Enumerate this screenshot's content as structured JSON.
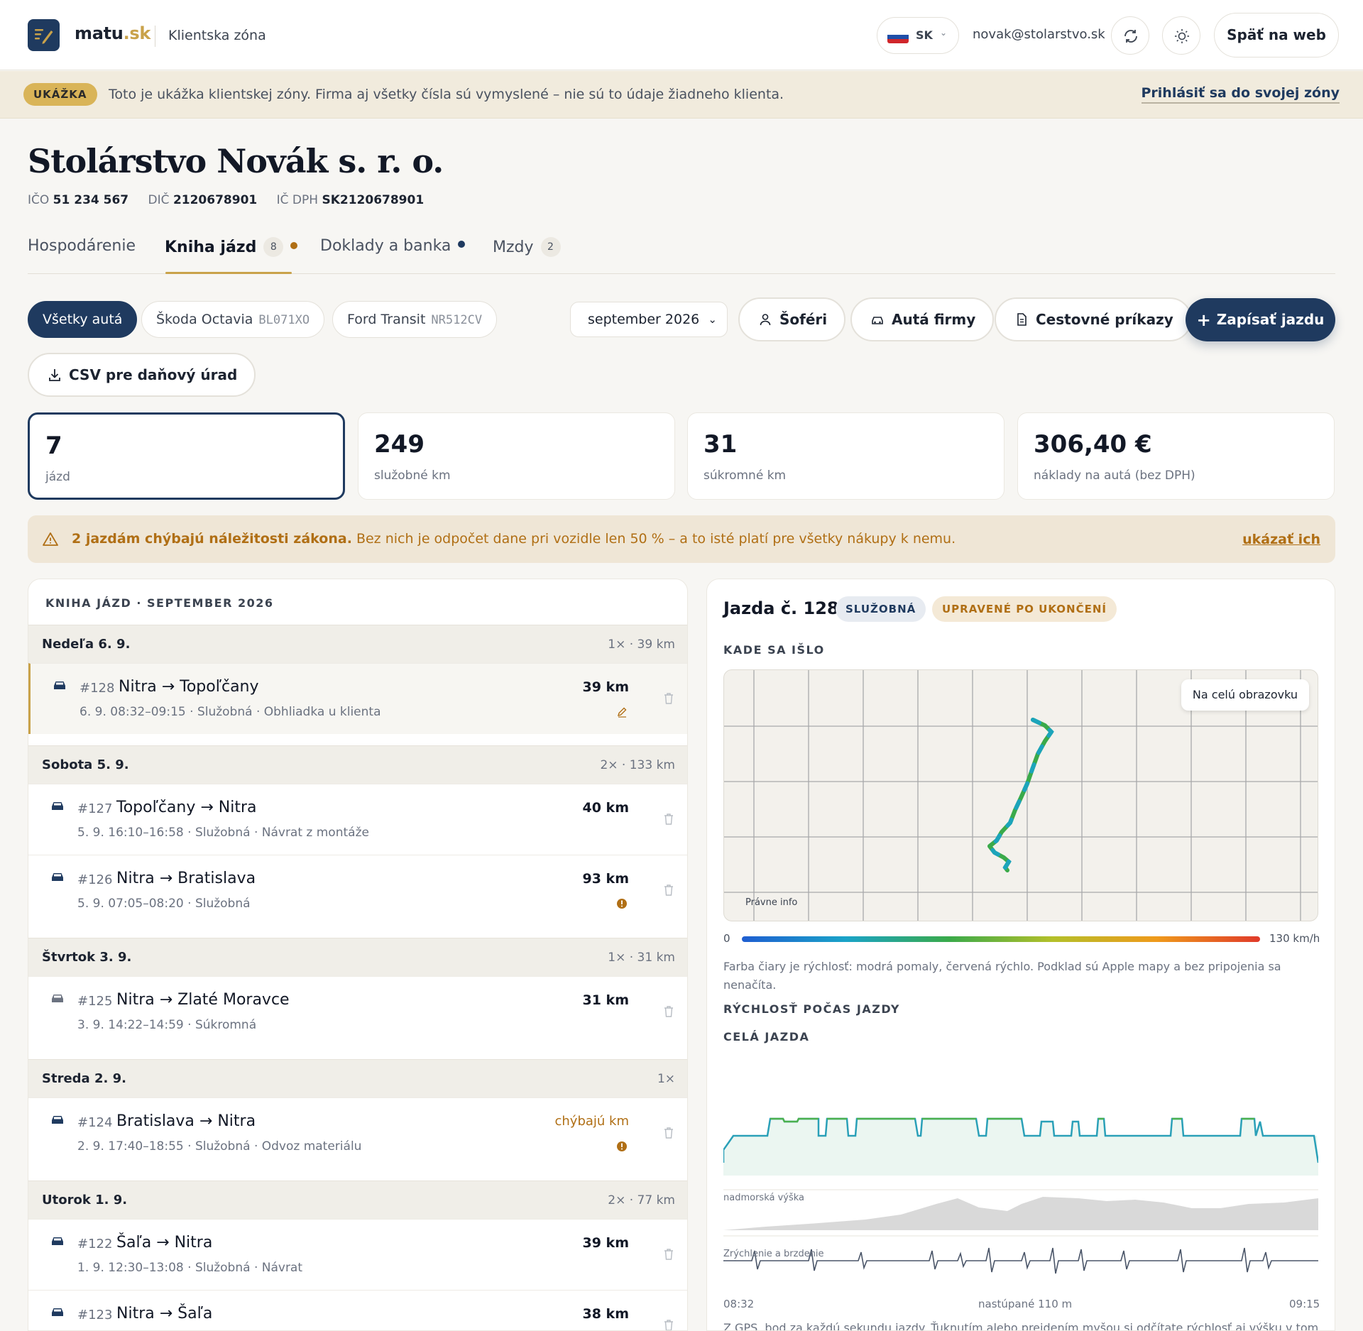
{
  "header": {
    "brand_main": "matu",
    "brand_tld": ".sk",
    "zone_title": "Klientska zóna",
    "lang_code": "SK",
    "user_email": "novak@stolarstvo.sk",
    "back_label": "Späť na web"
  },
  "demo": {
    "badge": "UKÁŽKA",
    "text": "Toto je ukážka klientskej zóny. Firma aj všetky čísla sú vymyslené – nie sú to údaje žiadneho klienta.",
    "login_link": "Prihlásiť sa do svojej zóny"
  },
  "company": {
    "name": "Stolárstvo Novák s. r. o.",
    "ico_label": "IČO",
    "ico": "51 234 567",
    "dic_label": "DIČ",
    "dic": "2120678901",
    "icdph_label": "IČ DPH",
    "icdph": "SK2120678901"
  },
  "tabs": [
    {
      "label": "Hospodárenie"
    },
    {
      "label": "Kniha jázd",
      "count": "8",
      "dot_color": "#b06f15"
    },
    {
      "label": "Doklady a banka",
      "dot_color": "#1f3a5f"
    },
    {
      "label": "Mzdy",
      "count": "2"
    }
  ],
  "filters": {
    "all_cars": "Všetky autá",
    "car1_name": "Škoda Octavia",
    "car1_plate": "BL071XO",
    "car2_name": "Ford Transit",
    "car2_plate": "NR512CV",
    "month": "september 2026",
    "drivers": "Šoféri",
    "company_cars": "Autá firmy",
    "travel_orders": "Cestovné príkazy",
    "add_trip": "Zapísať jazdu",
    "csv": "CSV pre daňový úrad"
  },
  "stats": [
    {
      "value": "7",
      "label": "jázd"
    },
    {
      "value": "249",
      "label": "služobné km"
    },
    {
      "value": "31",
      "label": "súkromné km"
    },
    {
      "value": "306,40 €",
      "label": "náklady na autá (bez DPH)"
    }
  ],
  "alert": {
    "bold": "2 jazdám chýbajú náležitosti zákona.",
    "text": " Bez nich je odpočet dane pri vozidle len 50 % – a to isté platí pre všetky nákupy k nemu.",
    "link": "ukázať ich"
  },
  "logbook": {
    "title": "KNIHA JÁZD · SEPTEMBER 2026",
    "days": [
      {
        "day": "Nedeľa 6. 9.",
        "summary": "1× · 39 km"
      },
      {
        "day": "Sobota 5. 9.",
        "summary": "2× · 133 km"
      },
      {
        "day": "Štvrtok 3. 9.",
        "summary": "1× · 31 km"
      },
      {
        "day": "Streda 2. 9.",
        "summary": "1×"
      },
      {
        "day": "Utorok 1. 9.",
        "summary": "2× · 77 km"
      }
    ],
    "trips": [
      {
        "num": "#128",
        "route": "Nitra → Topoľčany",
        "meta": "6. 9. 08:32–09:15 · Služobná · Obhliadka u klienta",
        "km": "39 km"
      },
      {
        "num": "#127",
        "route": "Topoľčany → Nitra",
        "meta": "5. 9. 16:10–16:58 · Služobná · Návrat z montáže",
        "km": "40 km"
      },
      {
        "num": "#126",
        "route": "Nitra → Bratislava",
        "meta": "5. 9. 07:05–08:20 · Služobná",
        "km": "93 km"
      },
      {
        "num": "#125",
        "route": "Nitra → Zlaté Moravce",
        "meta": "3. 9. 14:22–14:59 · Súkromná",
        "km": "31 km"
      },
      {
        "num": "#124",
        "route": "Bratislava → Nitra",
        "meta": "2. 9. 17:40–18:55 · Služobná · Odvoz materiálu",
        "km": "chýbajú km"
      },
      {
        "num": "#122",
        "route": "Šaľa → Nitra",
        "meta": "1. 9. 12:30–13:08 · Služobná · Návrat",
        "km": "39 km"
      },
      {
        "num": "#123",
        "route": "Nitra → Šaľa",
        "meta": "",
        "km": "38 km"
      }
    ]
  },
  "detail": {
    "title": "Jazda č. 128",
    "badge_type": "SLUŽOBNÁ",
    "badge_edit": "UPRAVENÉ PO UKONČENÍ",
    "route_section": "KADE SA IŠLO",
    "fullscreen": "Na celú obrazovku",
    "legal": "Právne info",
    "scale_min": "0",
    "scale_max": "130 km/h",
    "note": "Farba čiary je rýchlosť: modrá pomaly, červená rýchlo. Podklad sú Apple mapy a bez pripojenia sa nenačíta.",
    "speed_section": "RÝCHLOSŤ POČAS JAZDY",
    "whole_trip": "CELÁ JAZDA",
    "elevation_label": "nadmorská výška",
    "accel_label": "Zrýchlenie a brzdenie",
    "time_start": "08:32",
    "climb": "nastúpané 110 m",
    "time_end": "09:15",
    "footnote": "Z GPS, bod za každú sekundu jazdy. Ťuknutím alebo prejdením myšou si odčítate rýchlosť aj výšku v tom"
  },
  "colors": {
    "primary": "#1f3a5f",
    "gold": "#c9a24a",
    "warning": "#b06f15"
  }
}
